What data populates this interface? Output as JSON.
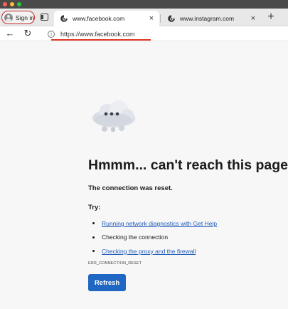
{
  "browser": {
    "signin_label": "Sign in",
    "tabs": [
      {
        "title": "www.facebook.com",
        "active": true,
        "close_glyph": "×",
        "icon": "edge-favicon-icon"
      },
      {
        "title": "www.instagram.com",
        "active": false,
        "close_glyph": "×",
        "icon": "edge-favicon-icon"
      }
    ],
    "new_tab_glyph": "+",
    "address": {
      "url": "https://www.facebook.com",
      "info_glyph": "i"
    },
    "nav": {
      "back_glyph": "←",
      "reload_glyph": "↻"
    }
  },
  "page": {
    "headline": "Hmmm... can't reach this page",
    "subhead": "The connection was reset.",
    "try_label": "Try:",
    "suggestions": [
      {
        "text": "Running network diagnostics with Get Help",
        "link": true
      },
      {
        "text": "Checking the connection",
        "link": false
      },
      {
        "text": "Checking the proxy and the firewall",
        "link": true
      }
    ],
    "error_code": "ERR_CONNECTION_RESET",
    "refresh_label": "Refresh"
  },
  "colors": {
    "accent": "#1f67c2",
    "link": "#1e5bb8",
    "annotation_red": "#e23a2a"
  }
}
